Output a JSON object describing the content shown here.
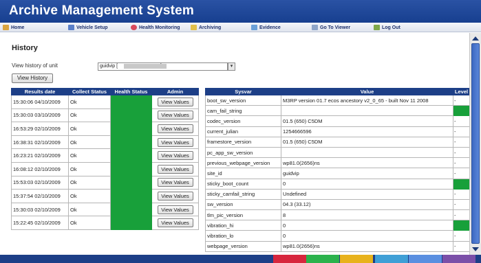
{
  "app": {
    "title": "Archive Management System"
  },
  "nav": [
    {
      "label": "Home",
      "icon": "home-icon"
    },
    {
      "label": "Vehicle Setup",
      "icon": "vehicle-icon"
    },
    {
      "label": "Health Monitoring",
      "icon": "heart-icon"
    },
    {
      "label": "Archiving",
      "icon": "archive-icon"
    },
    {
      "label": "Evidence",
      "icon": "evidence-icon"
    },
    {
      "label": "Go To Viewer",
      "icon": "viewer-icon"
    },
    {
      "label": "Log Out",
      "icon": "logout-icon"
    }
  ],
  "page": {
    "title": "History",
    "unit_label": "View history of unit",
    "unit_value": "guidvip [",
    "unit_value_end": "]",
    "view_button": "View History"
  },
  "history": {
    "headers": [
      "Results date",
      "Collect Status",
      "Health Status",
      "Admin"
    ],
    "button_label": "View Values",
    "rows": [
      {
        "date": "15:30:06 04/10/2009",
        "collect": "Ok"
      },
      {
        "date": "15:30:03 03/10/2009",
        "collect": "Ok"
      },
      {
        "date": "16:53:29 02/10/2009",
        "collect": "Ok"
      },
      {
        "date": "16:38:31 02/10/2009",
        "collect": "Ok"
      },
      {
        "date": "16:23:21 02/10/2009",
        "collect": "Ok"
      },
      {
        "date": "16:08:12 02/10/2009",
        "collect": "Ok"
      },
      {
        "date": "15:53:03 02/10/2009",
        "collect": "Ok"
      },
      {
        "date": "15:37:54 02/10/2009",
        "collect": "Ok"
      },
      {
        "date": "15:30:03 02/10/2009",
        "collect": "Ok"
      },
      {
        "date": "15:22:45 02/10/2009",
        "collect": "Ok"
      }
    ]
  },
  "sysvars": {
    "headers": [
      "Sysvar",
      "Value",
      "Level"
    ],
    "rows": [
      {
        "name": "boot_sw_version",
        "value": "M3RP version 01.7 ecos ancestory v2_0_65 - built Nov 11 2008",
        "level": "-",
        "green": false
      },
      {
        "name": "cam_fail_string",
        "value": "",
        "level": "",
        "green": true
      },
      {
        "name": "codec_version",
        "value": "01.5 (650) C5DM",
        "level": "-",
        "green": false
      },
      {
        "name": "current_julian",
        "value": "1254666596",
        "level": "-",
        "green": false
      },
      {
        "name": "framestore_version",
        "value": "01.5 (650) C5DM",
        "level": "-",
        "green": false
      },
      {
        "name": "pc_app_sw_version",
        "value": "",
        "level": "-",
        "green": false
      },
      {
        "name": "previous_webpage_version",
        "value": "wp81.0(2656)ns",
        "level": "-",
        "green": false
      },
      {
        "name": "site_id",
        "value": "guidvip",
        "level": "-",
        "green": false
      },
      {
        "name": "sticky_boot_count",
        "value": "0",
        "level": "",
        "green": true
      },
      {
        "name": "sticky_camfail_string",
        "value": "Undefined",
        "level": "-",
        "green": false
      },
      {
        "name": "sw_version",
        "value": "04.3 (33.12)",
        "level": "-",
        "green": false
      },
      {
        "name": "tlm_pic_version",
        "value": "8",
        "level": "-",
        "green": false
      },
      {
        "name": "vibration_hi",
        "value": "0",
        "level": "",
        "green": true
      },
      {
        "name": "vibration_lo",
        "value": "0",
        "level": "-",
        "green": false
      },
      {
        "name": "webpage_version",
        "value": "wp81.0(2656)ns",
        "level": "-",
        "green": false
      }
    ]
  },
  "colors": {
    "header_blue": "#1d3f87",
    "health_green": "#18a03a",
    "footer_segments": [
      "#d7263d",
      "#2bb24c",
      "#e8b21c",
      "#3f9fd6",
      "#5a8fe0",
      "#7b4fa8"
    ]
  }
}
